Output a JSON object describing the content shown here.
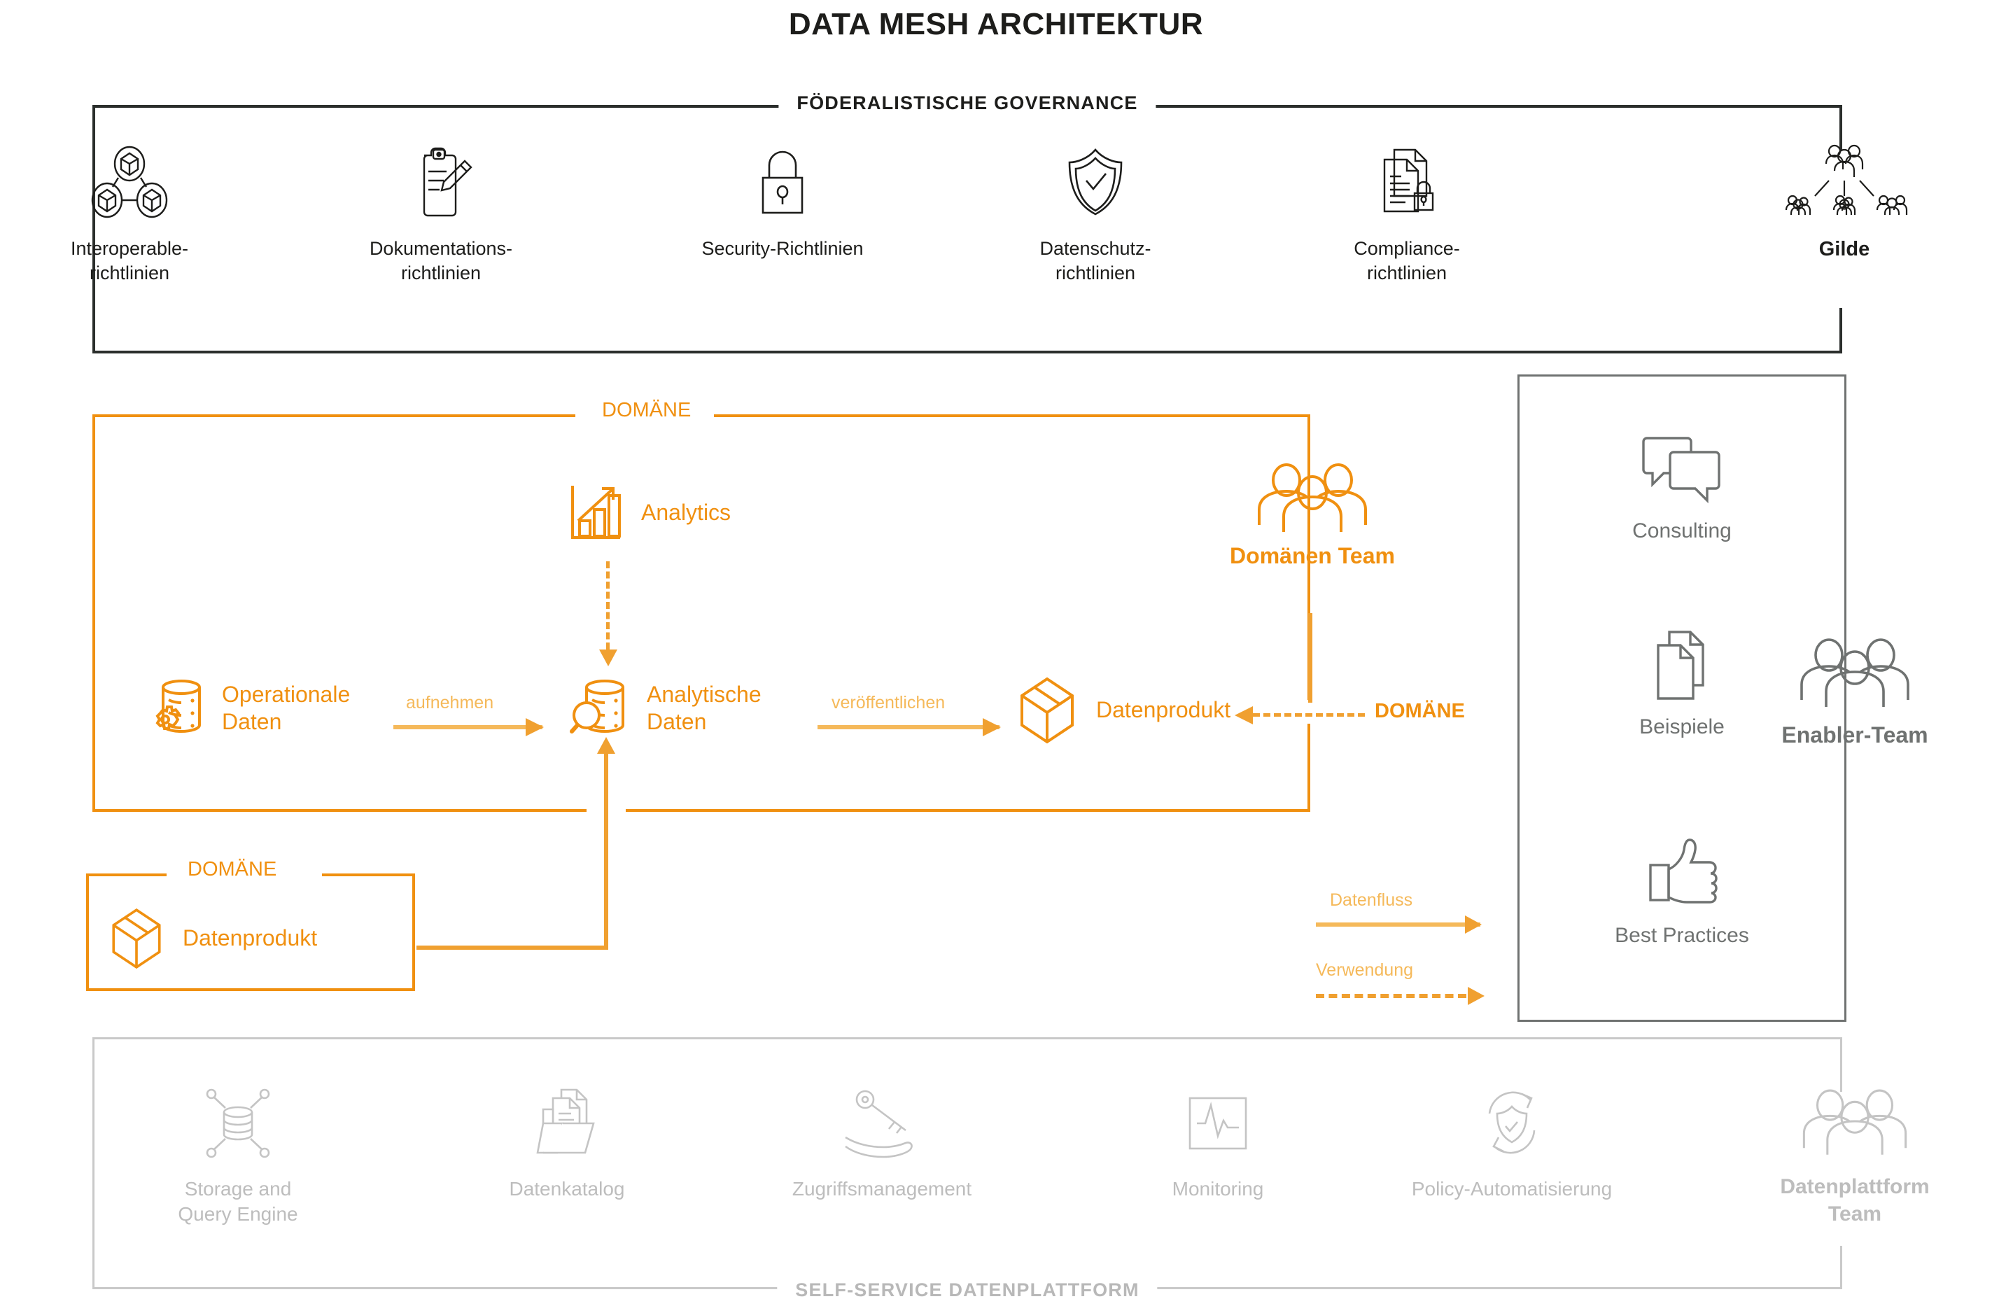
{
  "title": "DATA MESH ARCHITEKTUR",
  "colors": {
    "orange": "#F09010",
    "orange_light": "#F5B95A",
    "dark": "#1d1d1b",
    "gray": "#6f7271",
    "gray_light": "#bdbdbd"
  },
  "governance": {
    "label": "FÖDERALISTISCHE GOVERNANCE",
    "items": [
      {
        "icon": "interoperability-nodes-icon",
        "label": "Interoperable-\nrichtlinien"
      },
      {
        "icon": "clipboard-pencil-icon",
        "label": "Dokumentations-\nrichtlinien"
      },
      {
        "icon": "padlock-icon",
        "label": "Security-Richtlinien"
      },
      {
        "icon": "shield-check-icon",
        "label": "Datenschutz-\nrichtlinien"
      },
      {
        "icon": "document-lock-icon",
        "label": "Compliance-\nrichtlinien"
      }
    ],
    "guild": {
      "icon": "guild-hierarchy-icon",
      "label": "Gilde"
    }
  },
  "domain": {
    "label": "DOMÄNE",
    "side_label": "DOMÄNE",
    "nodes": {
      "analytics": {
        "icon": "bar-chart-growth-icon",
        "label": "Analytics"
      },
      "operational": {
        "icon": "database-gear-icon",
        "label": "Operationale\nDaten"
      },
      "analytical": {
        "icon": "database-search-icon",
        "label": "Analytische\nDaten"
      },
      "data_product": {
        "icon": "cube-box-icon",
        "label": "Datenprodukt"
      },
      "domain_team": {
        "icon": "people-group-icon",
        "label": "Domänen Team"
      }
    },
    "arrows": {
      "ingest": "aufnehmen",
      "publish": "veröffentlichen"
    }
  },
  "domain_lower": {
    "label": "DOMÄNE",
    "node": {
      "icon": "cube-box-icon",
      "label": "Datenprodukt"
    }
  },
  "enabler": {
    "items": [
      {
        "icon": "speech-bubbles-icon",
        "label": "Consulting"
      },
      {
        "icon": "documents-icon",
        "label": "Beispiele"
      },
      {
        "icon": "thumbs-up-icon",
        "label": "Best Practices"
      }
    ],
    "team": {
      "icon": "people-group-icon",
      "label": "Enabler-Team"
    }
  },
  "legend": {
    "data_flow": "Datenfluss",
    "usage": "Verwendung"
  },
  "platform": {
    "label": "SELF-SERVICE DATENPLATTFORM",
    "items": [
      {
        "icon": "storage-query-engine-icon",
        "label": "Storage and\nQuery Engine"
      },
      {
        "icon": "data-catalog-folder-icon",
        "label": "Datenkatalog"
      },
      {
        "icon": "key-hand-icon",
        "label": "Zugriffsmanagement"
      },
      {
        "icon": "monitoring-pulse-icon",
        "label": "Monitoring"
      },
      {
        "icon": "policy-automation-icon",
        "label": "Policy-Automatisierung"
      }
    ],
    "team": {
      "icon": "people-group-icon",
      "label": "Datenplattform\nTeam"
    }
  }
}
